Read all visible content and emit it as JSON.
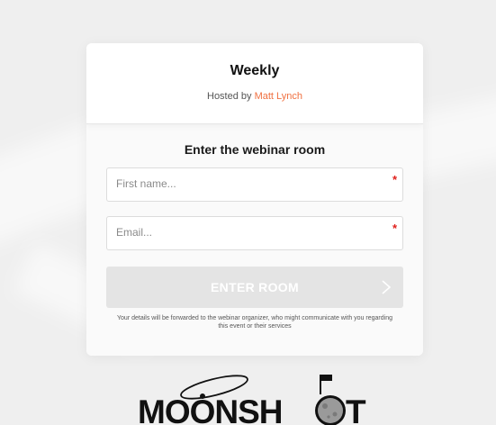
{
  "event": {
    "title": "Weekly",
    "hosted_prefix": "Hosted by ",
    "host_name": "Matt Lynch"
  },
  "form": {
    "heading": "Enter the webinar room",
    "first_name_placeholder": "First name...",
    "email_placeholder": "Email...",
    "required_mark": "*",
    "submit_label": "ENTER ROOM",
    "disclaimer": "Your details will be forwarded to the webinar organizer, who might communicate with you regarding this event or their services"
  },
  "logo": {
    "text_left": "MOONSH",
    "text_right": "T"
  },
  "colors": {
    "host_accent": "#f07040",
    "required": "#e0201c",
    "button_disabled": "#e4e4e4",
    "logo": "#111111"
  }
}
